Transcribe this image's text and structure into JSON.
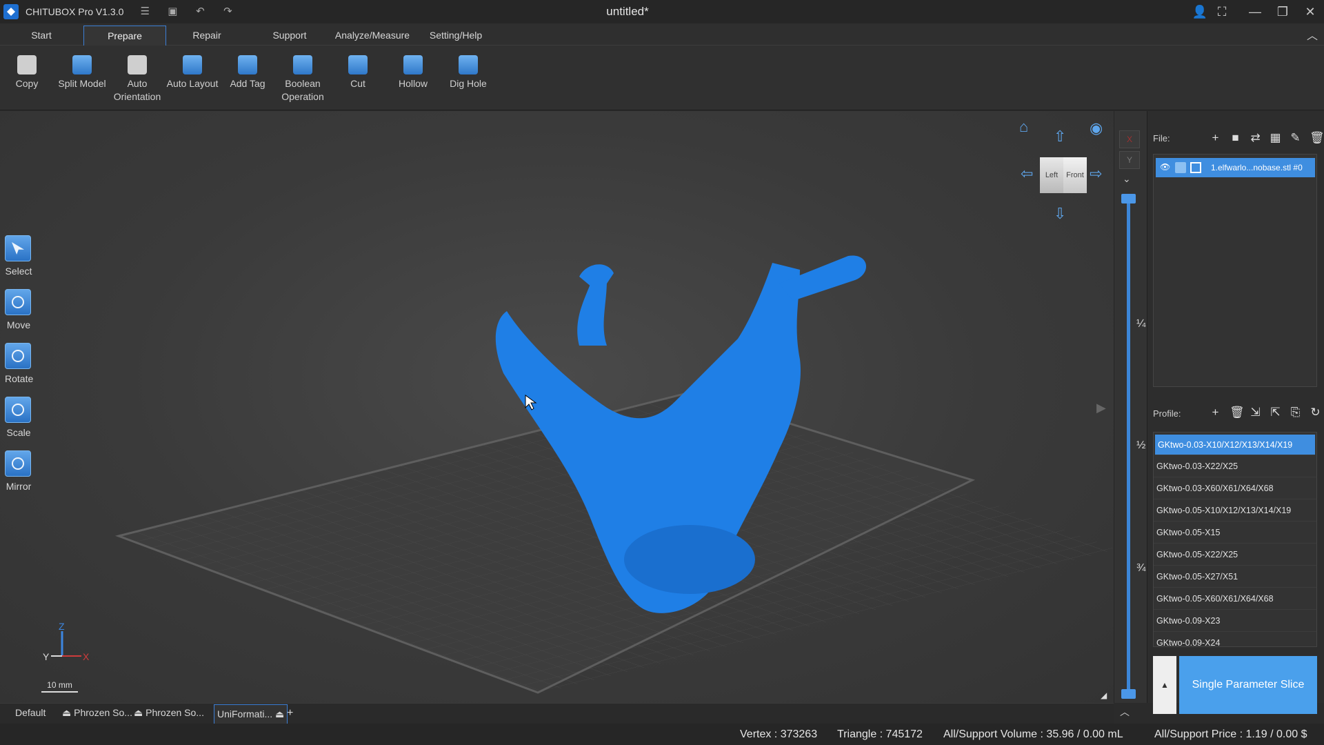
{
  "titlebar": {
    "app_name": "CHITUBOX Pro V1.3.0",
    "document_title": "untitled*",
    "quick_icons": [
      "file-list-icon",
      "save-icon",
      "undo-icon",
      "redo-icon"
    ],
    "window_icons": [
      "user-icon",
      "screenshot-icon",
      "minimize-icon",
      "restore-icon",
      "close-icon"
    ]
  },
  "menu": {
    "tabs": [
      "Start",
      "Prepare",
      "Repair",
      "Support",
      "Analyze/Measure",
      "Setting/Help"
    ],
    "active": "Prepare"
  },
  "ribbon": {
    "tools": [
      {
        "l1": "Copy",
        "l2": "",
        "icon": "copy-icon"
      },
      {
        "l1": "Split Model",
        "l2": "",
        "icon": "split-model-icon"
      },
      {
        "l1": "Auto",
        "l2": "Orientation",
        "icon": "auto-orientation-icon"
      },
      {
        "l1": "Auto Layout",
        "l2": "",
        "icon": "auto-layout-icon"
      },
      {
        "l1": "Add Tag",
        "l2": "",
        "icon": "add-tag-icon"
      },
      {
        "l1": "Boolean",
        "l2": "Operation",
        "icon": "boolean-operation-icon"
      },
      {
        "l1": "Cut",
        "l2": "",
        "icon": "cut-icon"
      },
      {
        "l1": "Hollow",
        "l2": "",
        "icon": "hollow-icon"
      },
      {
        "l1": "Dig Hole",
        "l2": "",
        "icon": "dig-hole-icon"
      }
    ]
  },
  "left_tools": [
    "Select",
    "Move",
    "Rotate",
    "Scale",
    "Mirror"
  ],
  "viewport": {
    "scale_label": "10 mm",
    "axis_labels": {
      "z": "Z",
      "y": "Y",
      "x": "X"
    },
    "cube": {
      "left": "Left",
      "front": "Front"
    }
  },
  "slider": {
    "fractions": [
      "¼",
      "½",
      "¾"
    ],
    "xy": {
      "x": "X",
      "y": "Y"
    }
  },
  "right_panel": {
    "file_label": "File:",
    "file_name": "1.elfwarlo...nobase.stl #0",
    "profile_label": "Profile:",
    "profiles": [
      "GKtwo-0.03-X10/X12/X13/X14/X19",
      "GKtwo-0.03-X22/X25",
      "GKtwo-0.03-X60/X61/X64/X68",
      "GKtwo-0.05-X10/X12/X13/X14/X19",
      "GKtwo-0.05-X15",
      "GKtwo-0.05-X22/X25",
      "GKtwo-0.05-X27/X51",
      "GKtwo-0.05-X60/X61/X64/X68",
      "GKtwo-0.09-X23",
      "GKtwo-0.09-X24"
    ],
    "selected_profile": 0,
    "slice_button": "Single Parameter Slice"
  },
  "bottom_tabs": [
    "Default",
    "Phrozen So...",
    "Phrozen So...",
    "UniFormati..."
  ],
  "status": {
    "vertex": "Vertex : 373263",
    "triangle": "Triangle : 745172",
    "volume": "All/Support Volume : 35.96 / 0.00 mL",
    "price": "All/Support Price : 1.19 / 0.00 $"
  },
  "colors": {
    "model": "#1f7fe6",
    "accent": "#3f8ee0",
    "slice_button": "#4aa0ec"
  }
}
